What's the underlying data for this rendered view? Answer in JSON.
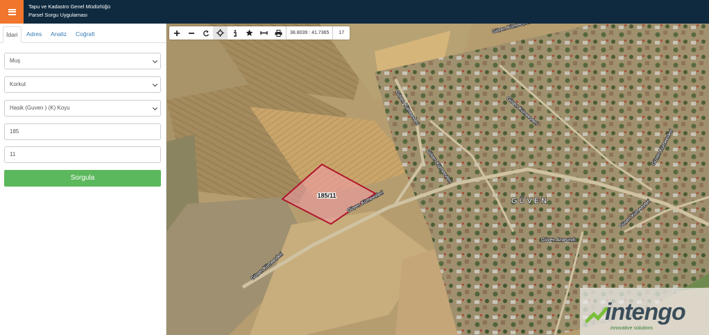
{
  "header": {
    "title_line1": "Tapu ve Kadastro Genel Müdürlüğü",
    "title_line2": "Parsel Sorgu Uygulaması"
  },
  "sidebar": {
    "tabs": [
      {
        "label": "İdari",
        "active": true
      },
      {
        "label": "Adres",
        "active": false
      },
      {
        "label": "Analiz",
        "active": false
      },
      {
        "label": "Coğrafi",
        "active": false
      }
    ],
    "il": "Muş",
    "ilce": "Korkut",
    "mahalle": "Hasik (Guven ) (K) Koyu",
    "ada": "185",
    "parsel": "11",
    "submit_label": "Sorgula"
  },
  "map": {
    "toolbar": {
      "icons": [
        "zoom-in-icon",
        "zoom-out-icon",
        "refresh-icon",
        "locate-icon",
        "info-icon",
        "bookmark-icon",
        "measure-icon",
        "print-icon"
      ],
      "coordinates": "38.8039 : 41.7365",
      "zoom_level": "17"
    },
    "parcel_label": "185/11",
    "labels": {
      "village": "GÜVEN",
      "school": "Güven Anasınıfı",
      "road1": "Güven Kümeevleri",
      "road2": "Güven Kümeevleri",
      "road3": "Güven Kümeevleri",
      "road4": "Güven Kümeevleri",
      "road5": "Güven Kümeevleri",
      "road6": "Güven Kümeevleri",
      "road7": "Güven Kümeevleri",
      "road8": "Güven Kümeevleri"
    },
    "watermark": {
      "brand": "intengo",
      "tagline": "innovative solutions"
    },
    "colors": {
      "parcel_fill": "#f29aa8",
      "parcel_stroke": "#b0152c",
      "header_bg": "#0f2a3f",
      "menu_accent": "#f0762d",
      "submit_bg": "#5cb85c"
    }
  }
}
